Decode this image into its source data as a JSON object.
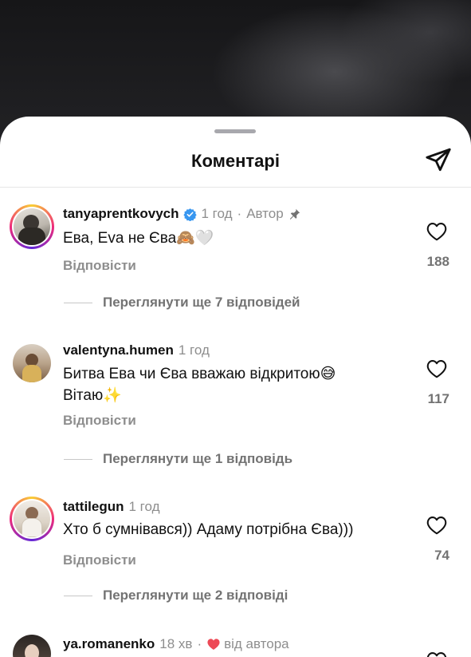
{
  "sheet": {
    "title": "Коментарі"
  },
  "icons": {
    "share": "paper-plane-icon",
    "like": "heart-outline-icon",
    "verified": "verified-badge-icon",
    "pin": "pin-icon",
    "creator_like": "red-heart-icon"
  },
  "colors": {
    "text": "#111111",
    "secondary": "#8e8e8e",
    "verified": "#3897f0",
    "heart_red": "#ed4956",
    "story_ring": [
      "#f9ce34",
      "#ee2a7b",
      "#6228d7"
    ]
  },
  "comments": [
    {
      "username": "tanyaprentkovych",
      "time": "1 год",
      "separator": "·",
      "badge": "Автор",
      "text": "Ева, Eva не Єва",
      "emoji": "🙈🤍",
      "reply_label": "Відповісти",
      "likes": "188",
      "view_replies": "Переглянути ще 7 відповідей"
    },
    {
      "username": "valentyna.humen",
      "time": "1 год",
      "text_line1": "Битва Ева чи Єва вважаю відкритою",
      "emoji1": "😅",
      "text_line2": "Вітаю",
      "emoji2": "✨",
      "reply_label": "Відповісти",
      "likes": "117",
      "view_replies": "Переглянути ще 1 відповідь"
    },
    {
      "username": "tattilegun",
      "time": "1 год",
      "text": "Хто б сумнівався)) Адаму потрібна Єва)))",
      "reply_label": "Відповісти",
      "likes": "74",
      "view_replies": "Переглянути ще 2 відповіді"
    },
    {
      "username": "ya.romanenko",
      "time": "18 хв",
      "separator": "·",
      "creator_liked": "від автора"
    }
  ]
}
